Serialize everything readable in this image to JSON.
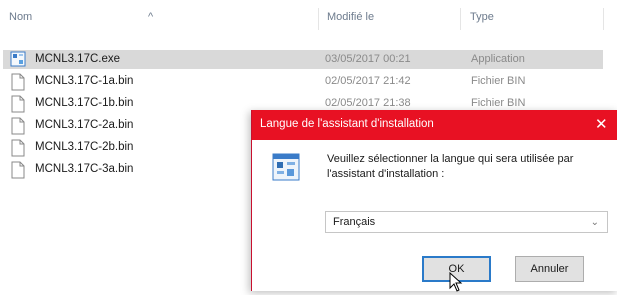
{
  "explorer": {
    "columns": {
      "name": "Nom",
      "modified": "Modifié le",
      "type": "Type"
    },
    "files": [
      {
        "name": "MCNL3.17C.exe",
        "date": "03/05/2017 00:21",
        "type": "Application",
        "icon": "installer-icon",
        "selected": true
      },
      {
        "name": "MCNL3.17C-1a.bin",
        "date": "02/05/2017 21:42",
        "type": "Fichier BIN",
        "icon": "file-icon",
        "selected": false
      },
      {
        "name": "MCNL3.17C-1b.bin",
        "date": "02/05/2017 21:38",
        "type": "Fichier BIN",
        "icon": "file-icon",
        "selected": false
      },
      {
        "name": "MCNL3.17C-2a.bin",
        "date": "",
        "type": "",
        "icon": "file-icon",
        "selected": false
      },
      {
        "name": "MCNL3.17C-2b.bin",
        "date": "",
        "type": "",
        "icon": "file-icon",
        "selected": false
      },
      {
        "name": "MCNL3.17C-3a.bin",
        "date": "",
        "type": "",
        "icon": "file-icon",
        "selected": false
      }
    ]
  },
  "dialog": {
    "title": "Langue de l'assistant d'installation",
    "close_symbol": "✕",
    "message": "Veuillez sélectionner la langue qui sera utilisée par l'assistant d'installation :",
    "language_selected": "Français",
    "ok_label": "OK",
    "cancel_label": "Annuler",
    "title_bar_color": "#e81123",
    "icon": "installer-icon"
  }
}
